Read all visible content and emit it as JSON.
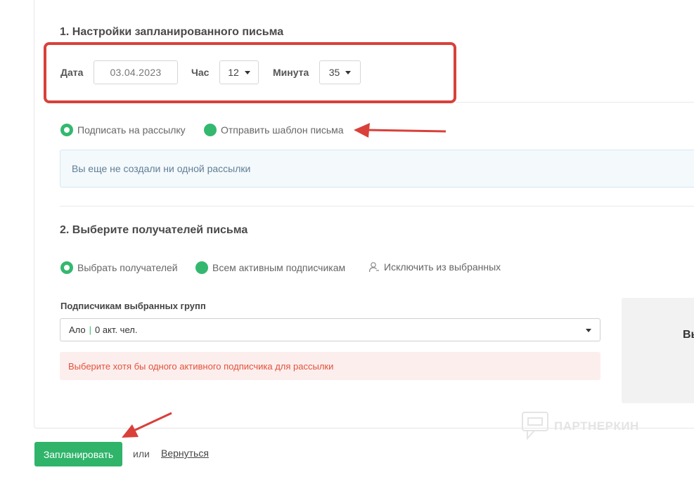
{
  "section1": {
    "title": "1. Настройки запланированного письма",
    "date_label": "Дата",
    "date_value": "03.04.2023",
    "hour_label": "Час",
    "hour_value": "12",
    "minute_label": "Минута",
    "minute_value": "35"
  },
  "mail_type": {
    "options": [
      {
        "label": "Подписать на рассылку",
        "checked": true
      },
      {
        "label": "Отправить шаблон письма",
        "checked": false
      }
    ],
    "info_message": "Вы еще не создали ни одной рассылки"
  },
  "section2": {
    "title": "2. Выберите получателей письма",
    "options": [
      {
        "label": "Выбрать получателей",
        "checked": true
      },
      {
        "label": "Всем активным подписчикам",
        "checked": false
      }
    ],
    "exclude_label": "Исключить из выбранных",
    "groups_label": "Подписчикам выбранных групп",
    "group_name": "Ало",
    "group_count": "0 акт. чел.",
    "error_message": "Выберите хотя бы одного активного подписчика для рассылки",
    "side_panel_text": "Вы"
  },
  "footer": {
    "submit_label": "Запланировать",
    "or_text": "или",
    "back_label": "Вернуться"
  },
  "watermark": {
    "text": "ПАРТНЕРКИН"
  },
  "colors": {
    "accent_green": "#2fb46a",
    "annotation_red": "#d9403a",
    "error_text": "#e0533a"
  },
  "icons": [
    "caret-down-icon",
    "person-exclude-icon",
    "watermark-logo-icon",
    "annotation-arrow-icon"
  ]
}
